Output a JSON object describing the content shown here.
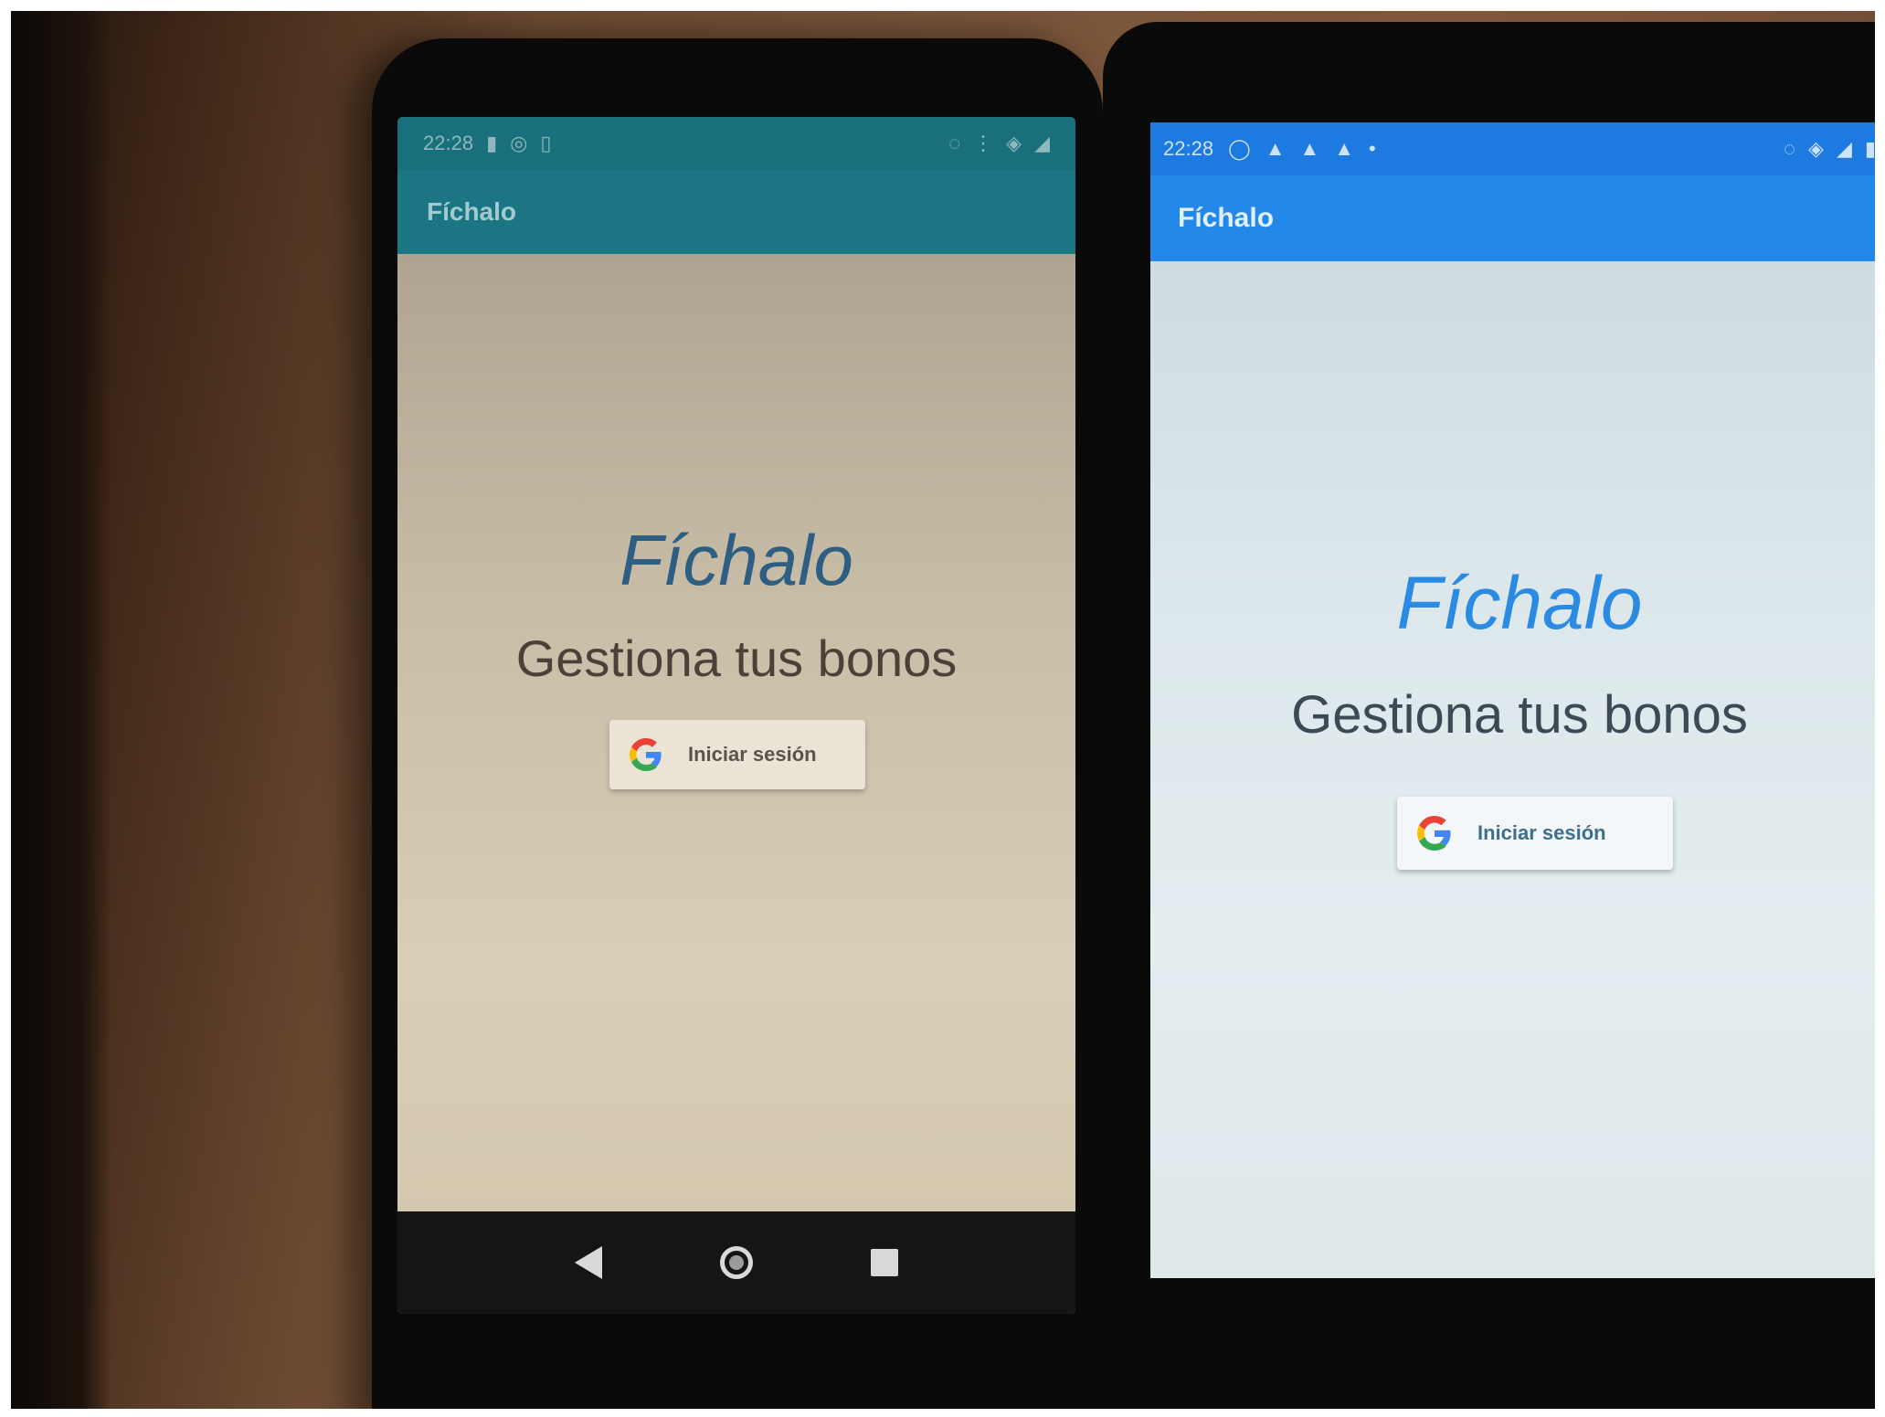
{
  "left_phone": {
    "status_time": "22:28",
    "app_title": "Fíchalo",
    "title": "Fíchalo",
    "subtitle": "Gestiona tus bonos",
    "signin_label": "Iniciar sesión",
    "nav_icons": [
      "back-icon",
      "home-icon",
      "recents-icon"
    ],
    "status_color": "#1a6f7c",
    "appbar_color": "#1c7583"
  },
  "right_phone": {
    "status_time": "22:28",
    "app_title": "Fíchalo",
    "title": "Fíchalo",
    "subtitle": "Gestiona tus bonos",
    "signin_label": "Iniciar sesión",
    "status_color": "#1c7ae0",
    "appbar_color": "#2289ea",
    "title_color": "#2b8ae2"
  }
}
